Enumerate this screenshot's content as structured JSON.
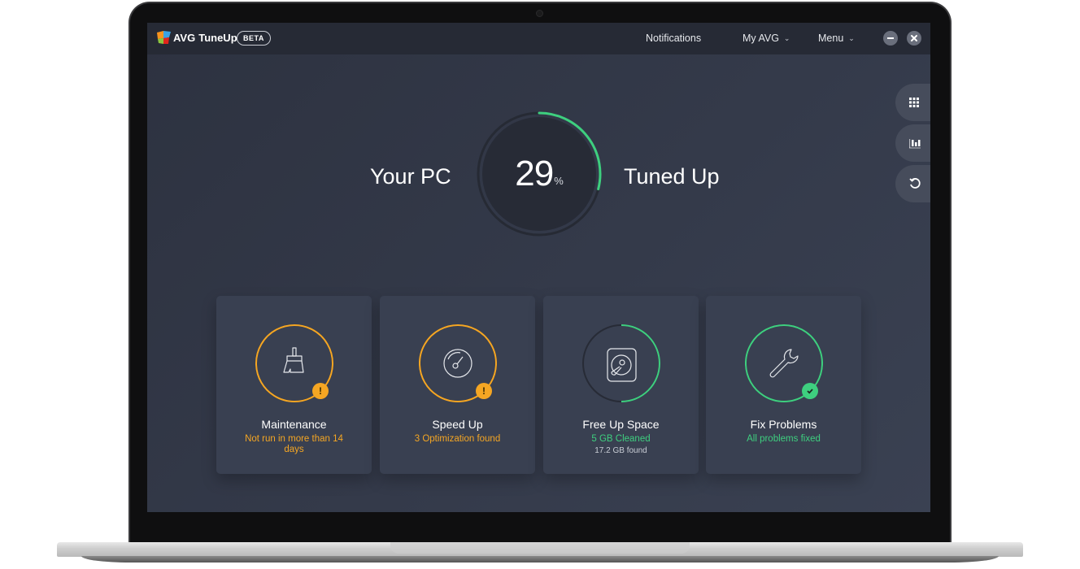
{
  "app": {
    "brand": "AVG",
    "product": "TuneUp",
    "badge": "BETA"
  },
  "nav": {
    "notifications": "Notifications",
    "my_avg": "My AVG",
    "menu": "Menu"
  },
  "window_controls": {
    "minimize": "minimize",
    "close": "close"
  },
  "side_buttons": [
    {
      "icon": "grid-icon"
    },
    {
      "icon": "bar-chart-icon"
    },
    {
      "icon": "undo-icon"
    }
  ],
  "hero": {
    "left_text": "Your PC",
    "right_text": "Tuned Up",
    "percent_value": "29",
    "percent_symbol": "%",
    "progress_fraction": 0.29
  },
  "colors": {
    "warning": "#f5a623",
    "success": "#3ecf7f",
    "background": "#2f3544",
    "card": "#394051"
  },
  "cards": [
    {
      "title": "Maintenance",
      "status": "Not run in more than 14 days",
      "detail": "",
      "state": "warning",
      "icon": "brush-icon",
      "progress_fraction": 1.0
    },
    {
      "title": "Speed Up",
      "status": "3 Optimization found",
      "detail": "",
      "state": "warning",
      "icon": "speedometer-icon",
      "progress_fraction": 1.0
    },
    {
      "title": "Free Up Space",
      "status": "5 GB Cleaned",
      "detail": "17.2 GB found",
      "state": "success",
      "icon": "hard-drive-icon",
      "progress_fraction": 0.5
    },
    {
      "title": "Fix Problems",
      "status": "All problems fixed",
      "detail": "",
      "state": "success",
      "icon": "wrench-icon",
      "progress_fraction": 1.0
    }
  ]
}
